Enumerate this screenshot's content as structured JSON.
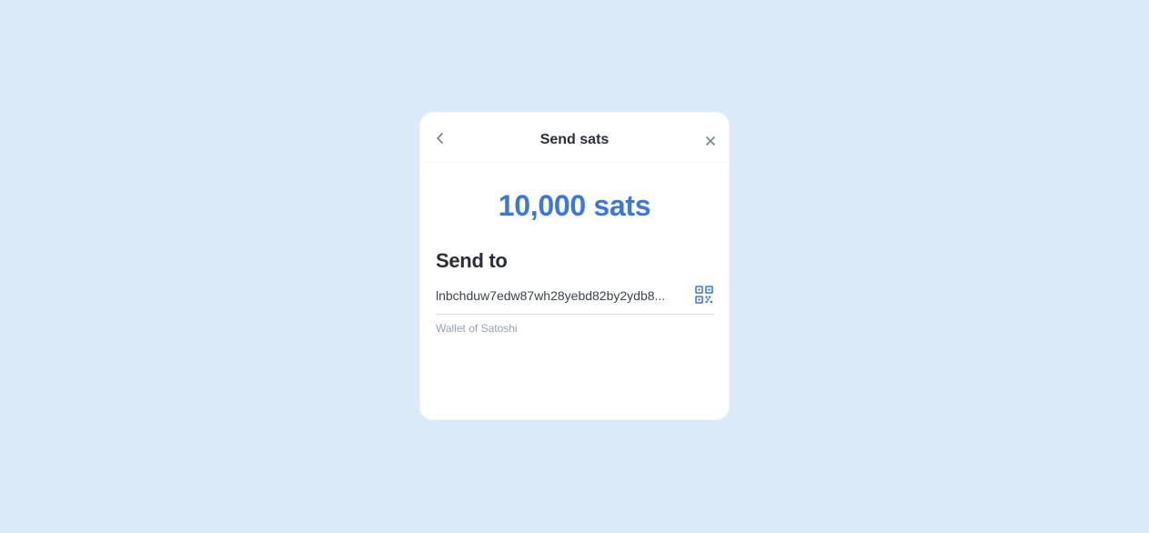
{
  "dialog": {
    "title": "Send sats",
    "back_icon": "chevron-left-icon",
    "close_icon": "close-icon"
  },
  "amount": {
    "text": "10,000 sats",
    "color": "#3c78d8"
  },
  "recipient": {
    "heading": "Send to",
    "address": "lnbchduw7edw87wh28yebd82by2ydb8...",
    "qr_icon": "qr-code-icon",
    "wallet_name": "Wallet of Satoshi"
  },
  "colors": {
    "background": "#dbeaf9",
    "card": "#ffffff",
    "accent": "#3c78d8"
  }
}
